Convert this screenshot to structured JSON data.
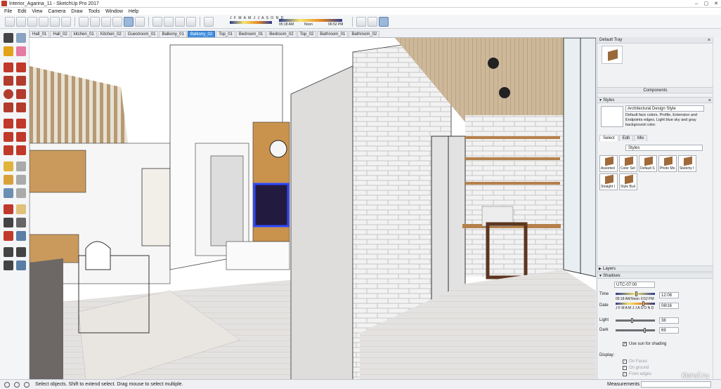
{
  "window": {
    "title": "Interior_Agarina_11 - SketchUp Pro 2017",
    "controls": [
      "–",
      "▢",
      "✕"
    ]
  },
  "menu": [
    "File",
    "Edit",
    "View",
    "Camera",
    "Draw",
    "Tools",
    "Window",
    "Help"
  ],
  "toolbar": {
    "months": "J F M A M J J A S O N D",
    "time_start": "05:18 AM",
    "time_noon": "Noon",
    "time_end": "06:52 PM"
  },
  "scene_tabs": [
    "Hall_01",
    "Hall_02",
    "kitchen_01",
    "Kitchen_02",
    "Guestroom_01",
    "Balkony_01",
    "Balkony_02",
    "Top_01",
    "Bedroom_01",
    "Bedroom_02",
    "Top_02",
    "Bathroom_01",
    "Bathroom_02"
  ],
  "active_scene": "Balkony_02",
  "tray": {
    "title": "Default Tray",
    "components_label": "Components",
    "styles_label": "Styles",
    "style_name": "Architectural Design Style",
    "style_description": "Default face colors. Profile, Extension and Endpoints edges. Light blue sky and gray background color.",
    "subtabs": [
      "Select",
      "Edit",
      "Mix"
    ],
    "style_collection": "Styles",
    "style_items": [
      "Assorted",
      "Color Set",
      "Default S",
      "Photo Mo",
      "Sketchy I",
      "Straight I",
      "Style Buil"
    ],
    "layers_label": "Layers",
    "shadows_label": "Shadows",
    "shadows": {
      "timezone": "UTC-07:00",
      "time_label": "Time",
      "time_start": "05:18 AM",
      "time_noon": "Noon",
      "time_end": "6:52 PM",
      "time_value": "12:08",
      "date_label": "Date",
      "months": "J F M A M J J A S O N D",
      "date_value": "08/16",
      "light_label": "Light",
      "light_value": "38",
      "dark_label": "Dark",
      "dark_value": "69",
      "use_sun": "Use sun for shading",
      "display_label": "Display:",
      "on_faces": "On Faces",
      "on_ground": "On ground",
      "from_edges": "From edges"
    }
  },
  "status": {
    "message": "Select objects. Shift to extend select. Drag mouse to select multiple.",
    "measurements_label": "Measurements"
  },
  "watermark": "Koruf.ru"
}
